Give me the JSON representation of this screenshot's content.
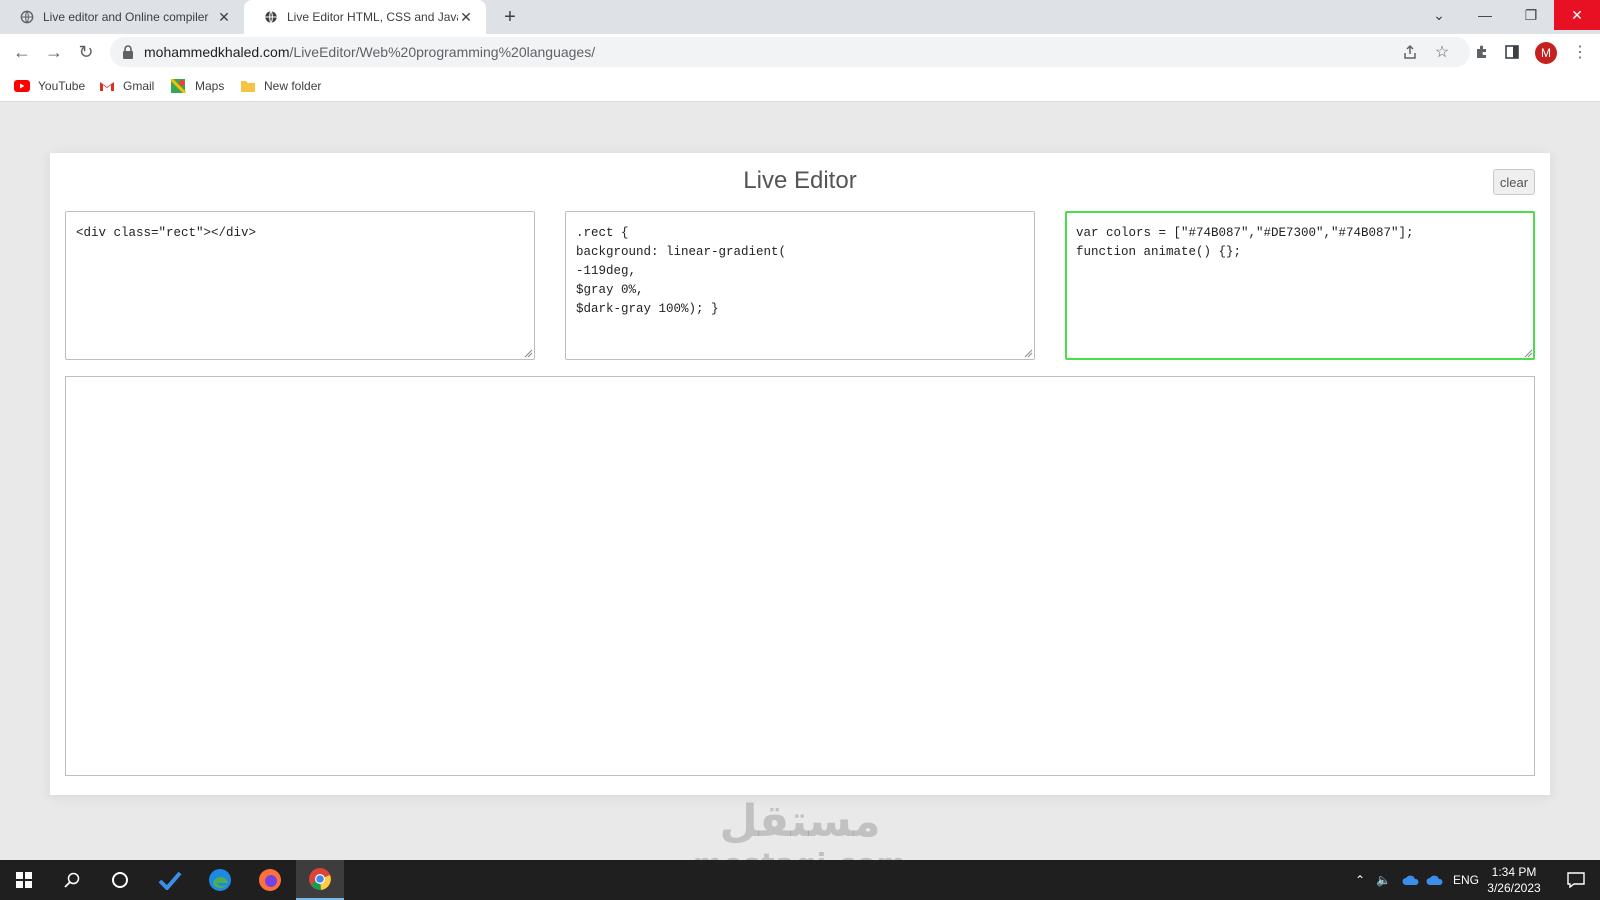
{
  "browser": {
    "tabs": [
      {
        "title": "Live editor and Online compiler",
        "active": false
      },
      {
        "title": "Live Editor HTML, CSS and JavaScript",
        "active": true
      }
    ],
    "address": {
      "host": "mohammedkhaled.com",
      "path": "/LiveEditor/Web%20programming%20languages/"
    },
    "profile_initial": "M",
    "bookmarks": [
      {
        "label": "YouTube",
        "icon": "youtube-icon"
      },
      {
        "label": "Gmail",
        "icon": "gmail-icon"
      },
      {
        "label": "Maps",
        "icon": "maps-icon"
      },
      {
        "label": "New folder",
        "icon": "folder-icon"
      }
    ]
  },
  "editor": {
    "title": "Live Editor",
    "clear_label": "clear",
    "html_code": "<div class=\"rect\"></div>",
    "css_code": ".rect {\nbackground: linear-gradient(\n-119deg,\n$gray 0%,\n$dark-gray 100%); }",
    "js_code": "var colors = [\"#74B087\",\"#DE7300\",\"#74B087\"];\nfunction animate() {};",
    "focused_border_color": "#4ade4a"
  },
  "watermark": {
    "arabic": "مستقل",
    "latin": "mostaqi.com"
  },
  "taskbar": {
    "language": "ENG",
    "time": "1:34 PM",
    "date": "3/26/2023"
  },
  "colors": {
    "close_button": "#e81123",
    "page_bg": "#e9e9e9",
    "taskbar_bg": "#1f1f1f"
  }
}
